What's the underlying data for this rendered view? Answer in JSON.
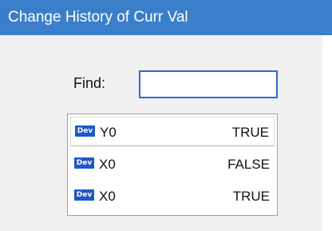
{
  "window": {
    "title": "Change History of Curr Val"
  },
  "find": {
    "label": "Find:",
    "value": "",
    "placeholder": ""
  },
  "history": {
    "items": [
      {
        "badge": "Dev",
        "name": "Y0",
        "value": "TRUE"
      },
      {
        "badge": "Dev",
        "name": "X0",
        "value": "FALSE"
      },
      {
        "badge": "Dev",
        "name": "X0",
        "value": "TRUE"
      }
    ]
  },
  "colors": {
    "titlebar": "#3b7ec9",
    "badge": "#1f57c8",
    "input_border": "#2a6fc2"
  }
}
